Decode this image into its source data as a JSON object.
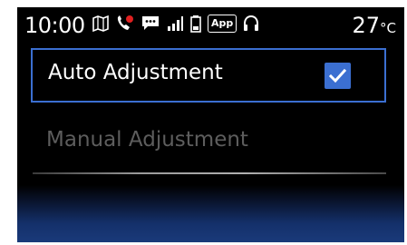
{
  "status": {
    "time": "10:00",
    "temperature": "27",
    "temperature_unit": "°C",
    "app_badge": "App",
    "icons": [
      "navigation-icon",
      "phone-missed-icon",
      "message-icon",
      "signal-icon",
      "battery-icon",
      "app-icon",
      "headset-icon"
    ]
  },
  "options": [
    {
      "label": "Auto Adjustment",
      "selected": true,
      "checked": true
    },
    {
      "label": "Manual Adjustment",
      "selected": false
    }
  ],
  "colors": {
    "accent": "#3b6fd1",
    "text": "#ffffff",
    "disabled_text": "#5d5d5d",
    "background": "#000000"
  }
}
